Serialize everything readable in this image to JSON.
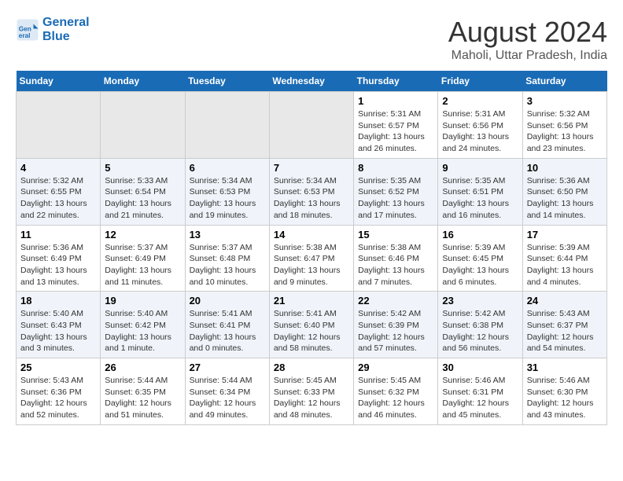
{
  "header": {
    "logo_line1": "General",
    "logo_line2": "Blue",
    "main_title": "August 2024",
    "subtitle": "Maholi, Uttar Pradesh, India"
  },
  "weekdays": [
    "Sunday",
    "Monday",
    "Tuesday",
    "Wednesday",
    "Thursday",
    "Friday",
    "Saturday"
  ],
  "weeks": [
    [
      {
        "day": "",
        "detail": ""
      },
      {
        "day": "",
        "detail": ""
      },
      {
        "day": "",
        "detail": ""
      },
      {
        "day": "",
        "detail": ""
      },
      {
        "day": "1",
        "detail": "Sunrise: 5:31 AM\nSunset: 6:57 PM\nDaylight: 13 hours\nand 26 minutes."
      },
      {
        "day": "2",
        "detail": "Sunrise: 5:31 AM\nSunset: 6:56 PM\nDaylight: 13 hours\nand 24 minutes."
      },
      {
        "day": "3",
        "detail": "Sunrise: 5:32 AM\nSunset: 6:56 PM\nDaylight: 13 hours\nand 23 minutes."
      }
    ],
    [
      {
        "day": "4",
        "detail": "Sunrise: 5:32 AM\nSunset: 6:55 PM\nDaylight: 13 hours\nand 22 minutes."
      },
      {
        "day": "5",
        "detail": "Sunrise: 5:33 AM\nSunset: 6:54 PM\nDaylight: 13 hours\nand 21 minutes."
      },
      {
        "day": "6",
        "detail": "Sunrise: 5:34 AM\nSunset: 6:53 PM\nDaylight: 13 hours\nand 19 minutes."
      },
      {
        "day": "7",
        "detail": "Sunrise: 5:34 AM\nSunset: 6:53 PM\nDaylight: 13 hours\nand 18 minutes."
      },
      {
        "day": "8",
        "detail": "Sunrise: 5:35 AM\nSunset: 6:52 PM\nDaylight: 13 hours\nand 17 minutes."
      },
      {
        "day": "9",
        "detail": "Sunrise: 5:35 AM\nSunset: 6:51 PM\nDaylight: 13 hours\nand 16 minutes."
      },
      {
        "day": "10",
        "detail": "Sunrise: 5:36 AM\nSunset: 6:50 PM\nDaylight: 13 hours\nand 14 minutes."
      }
    ],
    [
      {
        "day": "11",
        "detail": "Sunrise: 5:36 AM\nSunset: 6:49 PM\nDaylight: 13 hours\nand 13 minutes."
      },
      {
        "day": "12",
        "detail": "Sunrise: 5:37 AM\nSunset: 6:49 PM\nDaylight: 13 hours\nand 11 minutes."
      },
      {
        "day": "13",
        "detail": "Sunrise: 5:37 AM\nSunset: 6:48 PM\nDaylight: 13 hours\nand 10 minutes."
      },
      {
        "day": "14",
        "detail": "Sunrise: 5:38 AM\nSunset: 6:47 PM\nDaylight: 13 hours\nand 9 minutes."
      },
      {
        "day": "15",
        "detail": "Sunrise: 5:38 AM\nSunset: 6:46 PM\nDaylight: 13 hours\nand 7 minutes."
      },
      {
        "day": "16",
        "detail": "Sunrise: 5:39 AM\nSunset: 6:45 PM\nDaylight: 13 hours\nand 6 minutes."
      },
      {
        "day": "17",
        "detail": "Sunrise: 5:39 AM\nSunset: 6:44 PM\nDaylight: 13 hours\nand 4 minutes."
      }
    ],
    [
      {
        "day": "18",
        "detail": "Sunrise: 5:40 AM\nSunset: 6:43 PM\nDaylight: 13 hours\nand 3 minutes."
      },
      {
        "day": "19",
        "detail": "Sunrise: 5:40 AM\nSunset: 6:42 PM\nDaylight: 13 hours\nand 1 minute."
      },
      {
        "day": "20",
        "detail": "Sunrise: 5:41 AM\nSunset: 6:41 PM\nDaylight: 13 hours\nand 0 minutes."
      },
      {
        "day": "21",
        "detail": "Sunrise: 5:41 AM\nSunset: 6:40 PM\nDaylight: 12 hours\nand 58 minutes."
      },
      {
        "day": "22",
        "detail": "Sunrise: 5:42 AM\nSunset: 6:39 PM\nDaylight: 12 hours\nand 57 minutes."
      },
      {
        "day": "23",
        "detail": "Sunrise: 5:42 AM\nSunset: 6:38 PM\nDaylight: 12 hours\nand 56 minutes."
      },
      {
        "day": "24",
        "detail": "Sunrise: 5:43 AM\nSunset: 6:37 PM\nDaylight: 12 hours\nand 54 minutes."
      }
    ],
    [
      {
        "day": "25",
        "detail": "Sunrise: 5:43 AM\nSunset: 6:36 PM\nDaylight: 12 hours\nand 52 minutes."
      },
      {
        "day": "26",
        "detail": "Sunrise: 5:44 AM\nSunset: 6:35 PM\nDaylight: 12 hours\nand 51 minutes."
      },
      {
        "day": "27",
        "detail": "Sunrise: 5:44 AM\nSunset: 6:34 PM\nDaylight: 12 hours\nand 49 minutes."
      },
      {
        "day": "28",
        "detail": "Sunrise: 5:45 AM\nSunset: 6:33 PM\nDaylight: 12 hours\nand 48 minutes."
      },
      {
        "day": "29",
        "detail": "Sunrise: 5:45 AM\nSunset: 6:32 PM\nDaylight: 12 hours\nand 46 minutes."
      },
      {
        "day": "30",
        "detail": "Sunrise: 5:46 AM\nSunset: 6:31 PM\nDaylight: 12 hours\nand 45 minutes."
      },
      {
        "day": "31",
        "detail": "Sunrise: 5:46 AM\nSunset: 6:30 PM\nDaylight: 12 hours\nand 43 minutes."
      }
    ]
  ]
}
